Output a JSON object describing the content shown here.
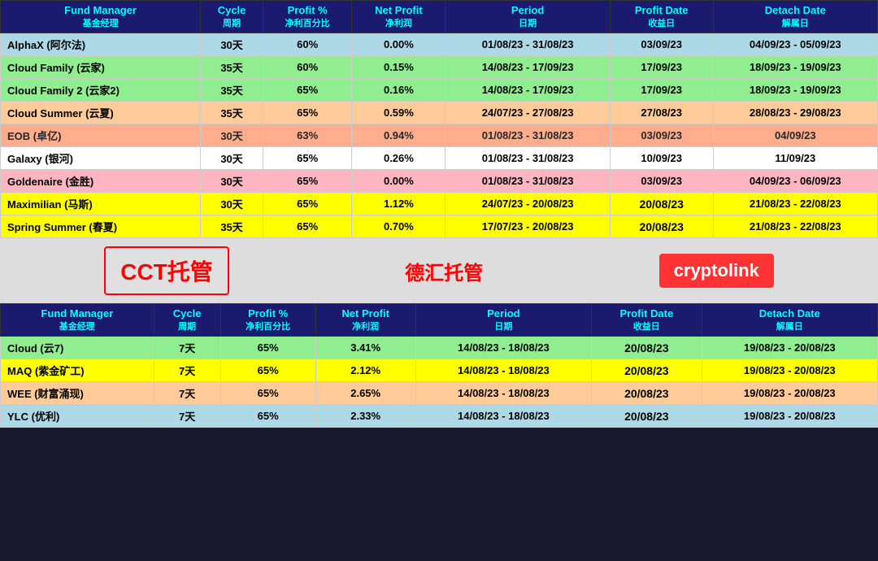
{
  "table1": {
    "headers": [
      {
        "label": "Fund Manager",
        "chinese": "基金经理"
      },
      {
        "label": "Cycle",
        "chinese": "周期"
      },
      {
        "label": "Profit %",
        "chinese": "净利百分比"
      },
      {
        "label": "Net Profit",
        "chinese": "净利润"
      },
      {
        "label": "Period",
        "chinese": "日期"
      },
      {
        "label": "Profit Date",
        "chinese": "收益日"
      },
      {
        "label": "Detach Date",
        "chinese": "解属日"
      }
    ],
    "rows": [
      {
        "name": "AlphaX (阿尔法)",
        "cycle": "30天",
        "profit_pct": "60%",
        "net_profit": "0.00%",
        "period": "01/08/23 - 31/08/23",
        "profit_date": "03/09/23",
        "detach_date": "04/09/23 - 05/09/23",
        "row_class": "row-light-blue"
      },
      {
        "name": "Cloud Family (云家)",
        "cycle": "35天",
        "profit_pct": "60%",
        "net_profit": "0.15%",
        "period": "14/08/23 - 17/09/23",
        "profit_date": "17/09/23",
        "detach_date": "18/09/23 - 19/09/23",
        "row_class": "row-light-green"
      },
      {
        "name": "Cloud Family 2 (云家2)",
        "cycle": "35天",
        "profit_pct": "65%",
        "net_profit": "0.16%",
        "period": "14/08/23 - 17/09/23",
        "profit_date": "17/09/23",
        "detach_date": "18/09/23 - 19/09/23",
        "row_class": "row-light-green"
      },
      {
        "name": "Cloud Summer (云夏)",
        "cycle": "35天",
        "profit_pct": "65%",
        "net_profit": "0.59%",
        "period": "24/07/23 - 27/08/23",
        "profit_date": "27/08/23",
        "detach_date": "28/08/23 - 29/08/23",
        "row_class": "row-peach"
      },
      {
        "name": "EOB (卓亿)",
        "cycle": "30天",
        "profit_pct": "63%",
        "net_profit": "0.94%",
        "period": "01/08/23 - 31/08/23",
        "profit_date": "03/09/23",
        "detach_date": "04/09/23",
        "row_class": "row-light-salmon",
        "date_bold": false
      },
      {
        "name": "Galaxy (银河)",
        "cycle": "30天",
        "profit_pct": "65%",
        "net_profit": "0.26%",
        "period": "01/08/23 - 31/08/23",
        "profit_date": "10/09/23",
        "detach_date": "11/09/23",
        "row_class": "row-white"
      },
      {
        "name": "Goldenaire (金胜)",
        "cycle": "30天",
        "profit_pct": "65%",
        "net_profit": "0.00%",
        "period": "01/08/23 - 31/08/23",
        "profit_date": "03/09/23",
        "detach_date": "04/09/23 - 06/09/23",
        "row_class": "row-pink"
      },
      {
        "name": "Maximilian (马斯)",
        "cycle": "30天",
        "profit_pct": "65%",
        "net_profit": "1.12%",
        "period": "24/07/23 - 20/08/23",
        "profit_date": "20/08/23",
        "detach_date": "21/08/23 - 22/08/23",
        "row_class": "row-yellow",
        "date_bold": true
      },
      {
        "name": "Spring Summer (春夏)",
        "cycle": "35天",
        "profit_pct": "65%",
        "net_profit": "0.70%",
        "period": "17/07/23 - 20/08/23",
        "profit_date": "20/08/23",
        "detach_date": "21/08/23 - 22/08/23",
        "row_class": "row-yellow",
        "date_bold": true
      }
    ]
  },
  "divider": {
    "cct": "CCT托管",
    "dehui": "德汇托管",
    "crypto": "cryptolink"
  },
  "table2": {
    "headers": [
      {
        "label": "Fund Manager",
        "chinese": "基金经理"
      },
      {
        "label": "Cycle",
        "chinese": "周期"
      },
      {
        "label": "Profit %",
        "chinese": "净利百分比"
      },
      {
        "label": "Net Profit",
        "chinese": "净利润"
      },
      {
        "label": "Period",
        "chinese": "日期"
      },
      {
        "label": "Profit Date",
        "chinese": "收益日"
      },
      {
        "label": "Detach Date",
        "chinese": "解属日"
      }
    ],
    "rows": [
      {
        "name": "Cloud (云7)",
        "cycle": "7天",
        "profit_pct": "65%",
        "net_profit": "3.41%",
        "period": "14/08/23 - 18/08/23",
        "profit_date": "20/08/23",
        "detach_date": "19/08/23 - 20/08/23",
        "row_class": "row-light-green",
        "date_bold": true
      },
      {
        "name": "MAQ (紫金矿工)",
        "cycle": "7天",
        "profit_pct": "65%",
        "net_profit": "2.12%",
        "period": "14/08/23 - 18/08/23",
        "profit_date": "20/08/23",
        "detach_date": "19/08/23 - 20/08/23",
        "row_class": "row-yellow",
        "date_bold": true
      },
      {
        "name": "WEE (财富涌现)",
        "cycle": "7天",
        "profit_pct": "65%",
        "net_profit": "2.65%",
        "period": "14/08/23 - 18/08/23",
        "profit_date": "20/08/23",
        "detach_date": "19/08/23 - 20/08/23",
        "row_class": "row-peach",
        "date_bold": true
      },
      {
        "name": "YLC (优利)",
        "cycle": "7天",
        "profit_pct": "65%",
        "net_profit": "2.33%",
        "period": "14/08/23 - 18/08/23",
        "profit_date": "20/08/23",
        "detach_date": "19/08/23 - 20/08/23",
        "row_class": "row-light-blue",
        "date_bold": true
      }
    ]
  }
}
